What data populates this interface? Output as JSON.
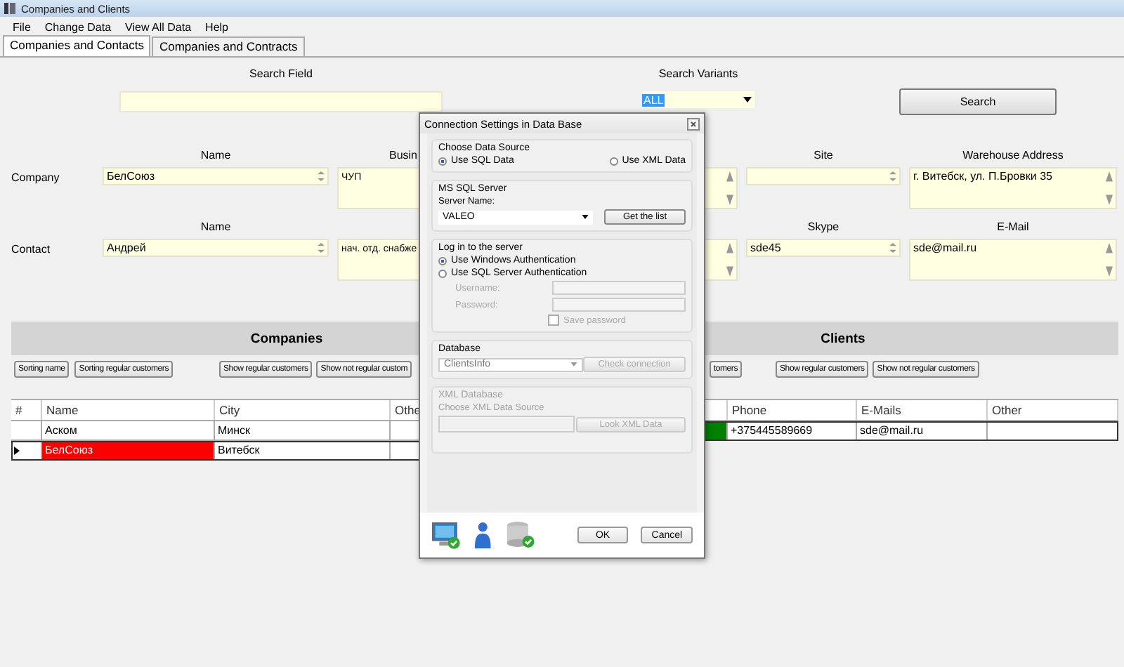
{
  "window": {
    "title": "Companies and Clients"
  },
  "menu": [
    "File",
    "Change Data",
    "View All Data",
    "Help"
  ],
  "tabs": [
    {
      "label": "Companies and Contacts",
      "selected": true
    },
    {
      "label": "Companies and Contracts",
      "selected": false
    }
  ],
  "search": {
    "field_label": "Search Field",
    "variants_label": "Search Variants",
    "variant": "ALL",
    "button": "Search"
  },
  "form_rows": [
    {
      "label": "Company",
      "fields": [
        {
          "kind": "line",
          "label": "Name",
          "value": "БелСоюз"
        },
        {
          "kind": "box",
          "label": "Busin",
          "value": "ЧУП"
        },
        {
          "kind": "line",
          "label": "Site"
        },
        {
          "kind": "box",
          "label": "Warehouse Address",
          "value": "г. Витебск, ул. П.Бровки 35"
        }
      ]
    },
    {
      "label": "Contact",
      "fields": [
        {
          "kind": "line",
          "label": "Name",
          "value": "Андрей"
        },
        {
          "kind": "box",
          "value": "нач. отд. снабже"
        },
        {
          "kind": "line",
          "label": "Skype",
          "value": "sde45"
        },
        {
          "kind": "box",
          "label": "E-Mail",
          "value": "sde@mail.ru"
        }
      ]
    }
  ],
  "panels": [
    {
      "title": "Companies",
      "sort_buttons": [
        "Sorting name",
        "Sorting regular customers"
      ],
      "show_buttons": [
        "Show regular customers",
        "Show not regular custom"
      ],
      "table": {
        "columns": [
          {
            "kind": "marker",
            "label": "#"
          },
          {
            "kind": "text",
            "label": "Name"
          },
          {
            "kind": "text",
            "label": "City"
          },
          {
            "kind": "text",
            "label": "Othe"
          }
        ],
        "rows": [
          {
            "selected": false,
            "cells": [
              {},
              {
                "text": "Аском"
              },
              {
                "text": "Минск"
              },
              {}
            ]
          },
          {
            "selected": true,
            "cells": [
              {},
              {
                "text": "БелСоюз",
                "color": "#ff0000"
              },
              {
                "text": "Витебск"
              },
              {}
            ]
          }
        ]
      }
    },
    {
      "title": "Clients",
      "sort_buttons": [
        "tomers"
      ],
      "show_buttons": [
        "Show regular customers",
        "Show not regular customers"
      ],
      "table": {
        "columns": [
          {
            "kind": "covered"
          },
          {
            "kind": "text",
            "label": "Phone"
          },
          {
            "kind": "text",
            "label": "E-Mails"
          },
          {
            "kind": "text",
            "label": "Other"
          }
        ],
        "rows": [
          {
            "selected": true,
            "cells": [
              {
                "color": "#008000"
              },
              {
                "text": "+375445589669"
              },
              {
                "text": "sde@mail.ru"
              },
              {}
            ]
          }
        ]
      }
    }
  ],
  "dialog": {
    "title": "Connection Settings in Data Base",
    "source": {
      "title": "Choose Data Source",
      "options": [
        {
          "label": "Use SQL Data",
          "selected": true
        },
        {
          "label": "Use XML Data",
          "selected": false
        }
      ]
    },
    "server": {
      "title": "MS SQL Server",
      "name_label": "Server Name:",
      "name": "VALEO",
      "button": "Get the list"
    },
    "login": {
      "title": "Log in to the server",
      "options": [
        {
          "label": "Use Windows Authentication",
          "selected": true
        },
        {
          "label": "Use SQL Server Authentication",
          "selected": false
        }
      ],
      "credentials_disabled": true,
      "fields": [
        {
          "label": "Username:"
        },
        {
          "label": "Password:"
        }
      ],
      "save": {
        "label": "Save password",
        "checked": false
      }
    },
    "database": {
      "title": "Database",
      "value": "ClientsInfo",
      "button": "Check connection",
      "button_disabled": true
    },
    "xml": {
      "title": "XML Database",
      "label": "Choose XML Data Source",
      "button": "Look XML Data",
      "disabled": true
    },
    "buttons": [
      "OK",
      "Cancel"
    ]
  }
}
